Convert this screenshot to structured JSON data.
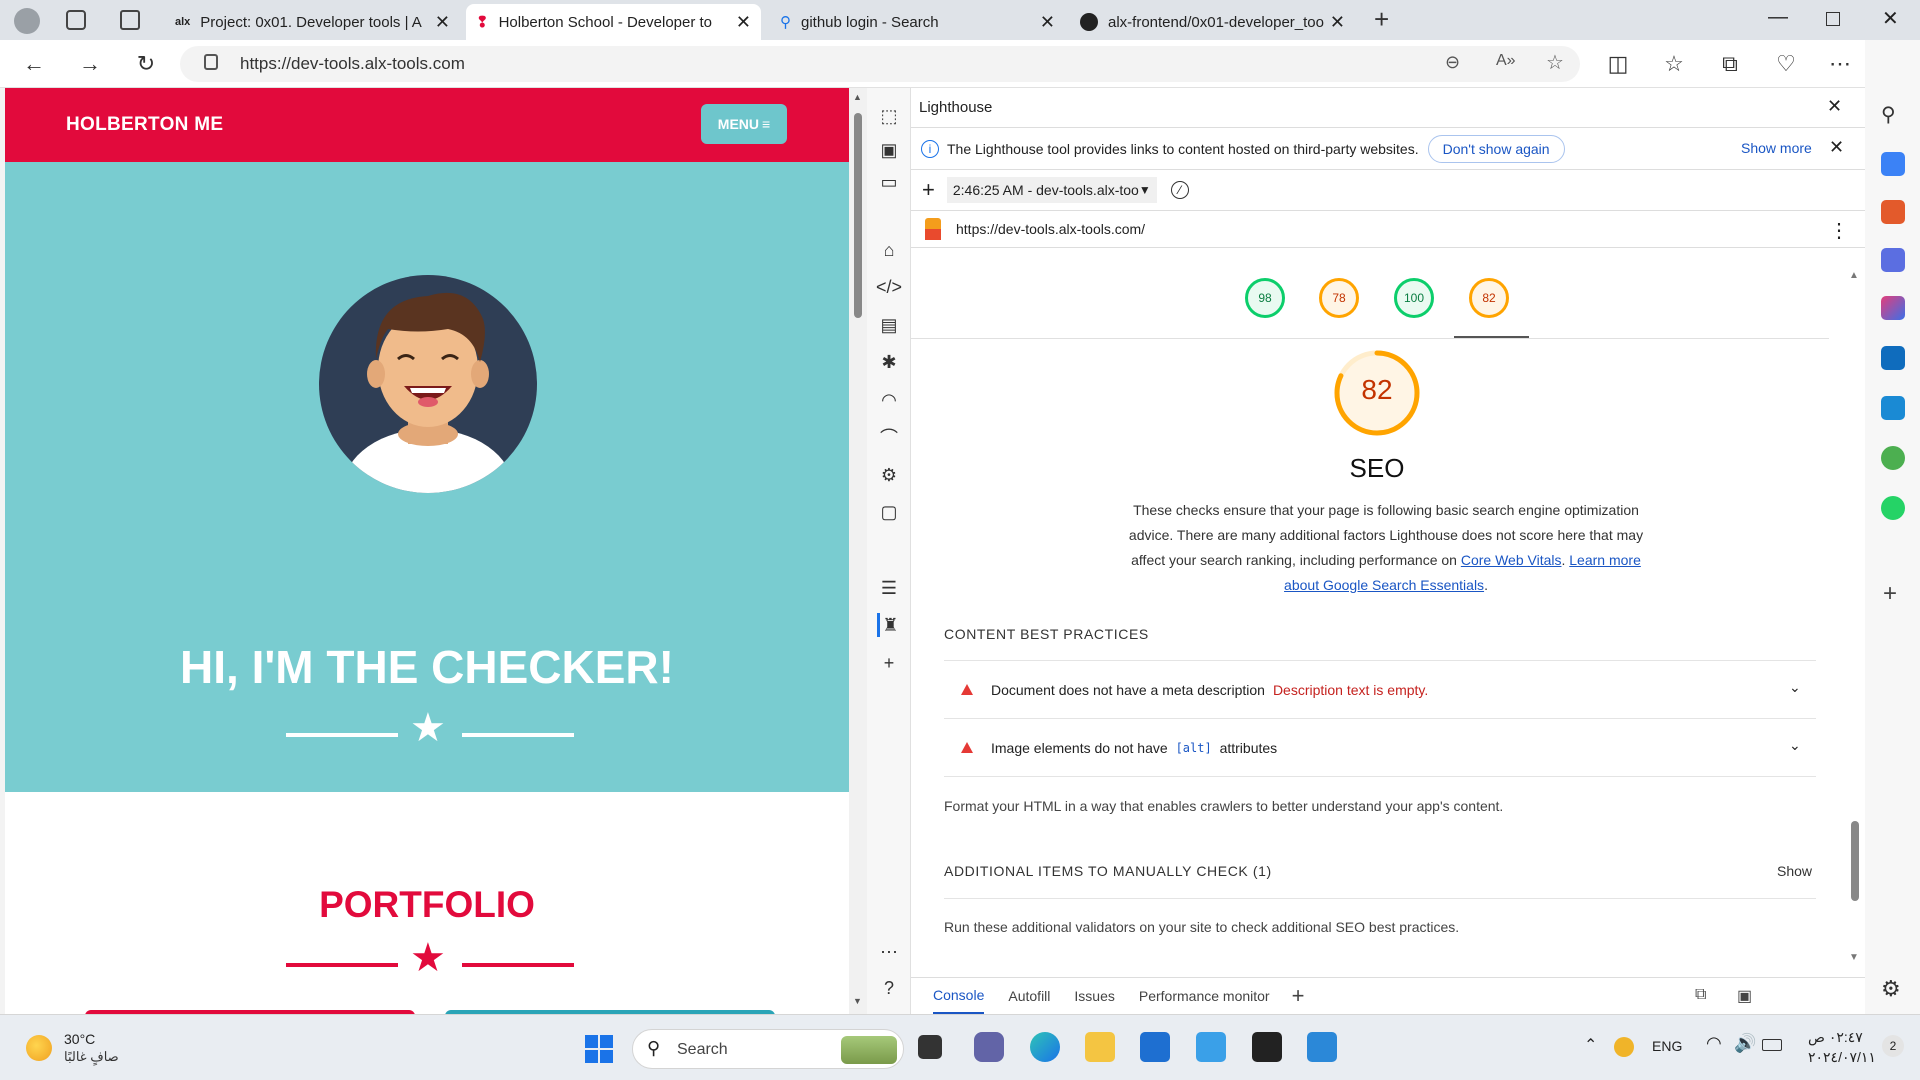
{
  "browser": {
    "tabs": [
      {
        "favicon": "alx-icon",
        "title": "Project: 0x01. Developer tools | A",
        "active": false
      },
      {
        "favicon": "holberton-icon",
        "title": "Holberton School - Developer to",
        "active": true
      },
      {
        "favicon": "search-icon",
        "title": "github login - Search",
        "active": false
      },
      {
        "favicon": "github-icon",
        "title": "alx-frontend/0x01-developer_too",
        "active": false
      }
    ],
    "url": "https://dev-tools.alx-tools.com"
  },
  "page": {
    "header_title": "HOLBERTON ME",
    "menu_label": "MENU",
    "hero_heading": "HI, I'M THE CHECKER!",
    "portfolio_heading": "PORTFOLIO",
    "colors": {
      "brand_red": "#e20a3c",
      "teal": "#79ccd0",
      "menu_teal": "#6ec6cc"
    }
  },
  "devtools": {
    "panel_title": "Lighthouse",
    "info_text": "The Lighthouse tool provides links to content hosted on third-party websites.",
    "dont_show_again": "Don't show again",
    "show_more": "Show more",
    "report_select": "2:46:25 AM - dev-tools.alx-too",
    "report_url": "https://dev-tools.alx-tools.com/",
    "scores": [
      {
        "value": "98",
        "status": "pass"
      },
      {
        "value": "78",
        "status": "average"
      },
      {
        "value": "100",
        "status": "pass"
      },
      {
        "value": "82",
        "status": "average"
      }
    ],
    "category": {
      "score": "82",
      "score_fraction": 0.82,
      "title": "SEO",
      "description": "These checks ensure that your page is following basic search engine optimization advice. There are many additional factors Lighthouse does not score here that may affect your search ranking, including performance on",
      "link1": "Core Web Vitals",
      "sep": ". ",
      "link2": "Learn more about Google Search Essentials",
      "end": "."
    },
    "content_best_practices": "CONTENT BEST PRACTICES",
    "audits": [
      {
        "title": "Document does not have a meta description",
        "extra": "Description text is empty."
      },
      {
        "title_pre": "Image elements do not have ",
        "code": "[alt]",
        "title_post": " attributes"
      }
    ],
    "format_text": "Format your HTML in a way that enables crawlers to better understand your app's content.",
    "manual_header": "ADDITIONAL ITEMS TO MANUALLY CHECK (1)",
    "show_label": "Show",
    "manual_text": "Run these additional validators on your site to check additional SEO best practices.",
    "drawer_tabs": [
      "Console",
      "Autofill",
      "Issues",
      "Performance monitor"
    ]
  },
  "taskbar": {
    "weather_temp": "30°C",
    "weather_desc": "صافٍ غالبًا",
    "search_label": "Search",
    "lang": "ENG",
    "time": "٠٢:٤٧ ص",
    "date": "٢٠٢٤/٠٧/١١",
    "notif_count": "2"
  }
}
